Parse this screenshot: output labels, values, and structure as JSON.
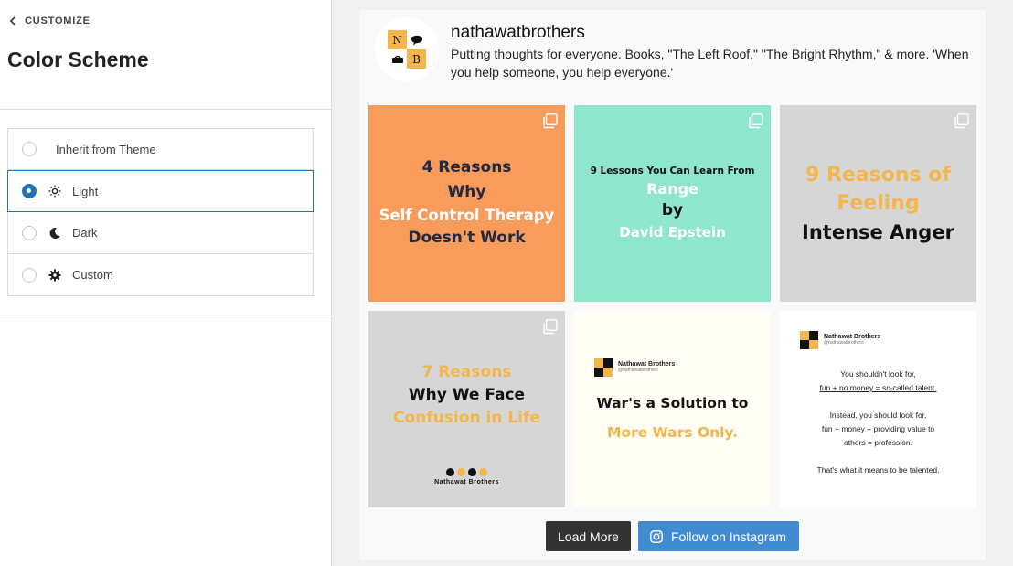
{
  "sidebar": {
    "back_label": "CUSTOMIZE",
    "title": "Color Scheme",
    "options": [
      {
        "label": "Inherit from Theme",
        "icon": "none",
        "selected": false
      },
      {
        "label": "Light",
        "icon": "sun-icon",
        "selected": true
      },
      {
        "label": "Dark",
        "icon": "moon-icon",
        "selected": false
      },
      {
        "label": "Custom",
        "icon": "gear-icon",
        "selected": false
      }
    ],
    "accent_color": "#2271b1"
  },
  "profile": {
    "username": "nathawatbrothers",
    "bio_line1": "Putting thoughts for everyone. Books, \"The Left Roof,\" \"The Bright Rhythm,\" & more. 'When",
    "bio_line2": "you help someone, you help everyone.'",
    "logo_letters": [
      "N",
      "B"
    ]
  },
  "posts": [
    {
      "bg": "#f99b5a",
      "lines": [
        "4 Reasons",
        "Why",
        "Self Control Therapy",
        "Doesn't Work"
      ]
    },
    {
      "bg": "#8ee6cd",
      "lines": [
        "9 Lessons You Can Learn From",
        "Range",
        "by",
        "David Epstein"
      ]
    },
    {
      "bg": "#d6d6d6",
      "lines": [
        "9 Reasons of",
        "Feeling",
        "Intense Anger"
      ]
    },
    {
      "bg": "#d6d6d6",
      "lines": [
        "7 Reasons",
        "Why We Face",
        "Confusion in Life"
      ],
      "footer": "Nathawat Brothers"
    },
    {
      "bg": "#fffdf4",
      "brand_name": "Nathawat Brothers",
      "brand_handle": "@nathawatbrothers",
      "lines": [
        "War's a Solution to",
        "More Wars Only."
      ]
    },
    {
      "bg": "#ffffff",
      "brand_name": "Nathawat Brothers",
      "brand_handle": "@nathawatbrothers",
      "lines": [
        "You shouldn't look for,",
        "fun + no money = so-called talent.",
        "Instead, you should look for,",
        "fun + money + providing value to",
        "others = profession.",
        "That's what it means to be talented."
      ]
    }
  ],
  "buttons": {
    "load_more": "Load More",
    "follow": "Follow on Instagram"
  }
}
